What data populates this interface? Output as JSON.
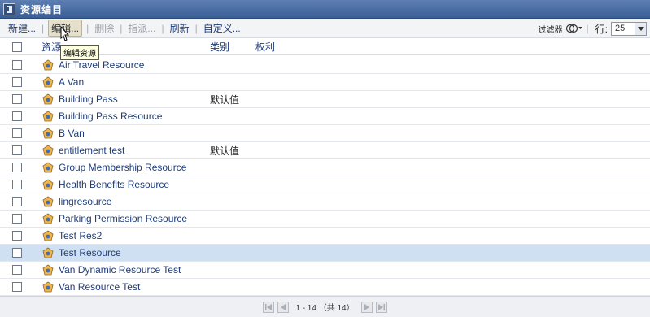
{
  "window": {
    "title": "资源编目"
  },
  "toolbar": {
    "new_label": "新建...",
    "edit_label": "编辑...",
    "delete_label": "删除",
    "assign_label": "指派...",
    "refresh_label": "刷新",
    "customize_label": "自定义...",
    "filter_label": "过滤器",
    "rows_label": "行:",
    "rows_value": "25"
  },
  "tooltip": {
    "text": "编辑资源"
  },
  "table": {
    "columns": {
      "name": "资源",
      "category": "类别",
      "rights": "权利"
    },
    "rows": [
      {
        "name": "Air Travel Resource",
        "category": ""
      },
      {
        "name": "A Van",
        "category": ""
      },
      {
        "name": "Building Pass",
        "category": "默认值"
      },
      {
        "name": "Building Pass Resource",
        "category": ""
      },
      {
        "name": "B Van",
        "category": ""
      },
      {
        "name": "entitlement test",
        "category": "默认值"
      },
      {
        "name": "Group Membership Resource",
        "category": ""
      },
      {
        "name": "Health Benefits Resource",
        "category": ""
      },
      {
        "name": "lingresource",
        "category": ""
      },
      {
        "name": "Parking Permission Resource",
        "category": ""
      },
      {
        "name": "Test Res2",
        "category": ""
      },
      {
        "name": "Test Resource",
        "category": ""
      },
      {
        "name": "Van Dynamic Resource Test",
        "category": ""
      },
      {
        "name": "Van Resource Test",
        "category": ""
      }
    ],
    "selected_index": 11
  },
  "pager": {
    "text": "1 - 14 （共 14）"
  },
  "colors": {
    "title_bar": "#4a6ea5",
    "selected_row": "#cfe0f2",
    "link": "#1f3d7a"
  },
  "icons": {
    "resource": "resource-icon",
    "filter": "filter-icon"
  }
}
